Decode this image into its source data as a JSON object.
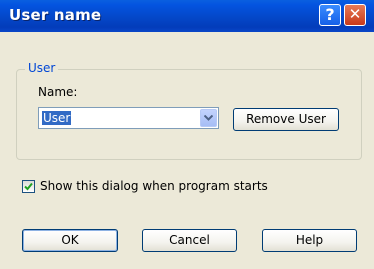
{
  "window": {
    "title": "User name",
    "help_button": "?",
    "close_button": "✕"
  },
  "group": {
    "label": "User",
    "name_label": "Name:",
    "name_value": "User",
    "remove_button": "Remove User"
  },
  "checkbox": {
    "label": "Show this dialog when program starts",
    "checked": true
  },
  "buttons": {
    "ok": "OK",
    "cancel": "Cancel",
    "help": "Help"
  },
  "colors": {
    "titlebar": "#0454e0",
    "dialog_bg": "#ece9d8",
    "selection": "#316ac5",
    "group_label": "#0046d5"
  }
}
